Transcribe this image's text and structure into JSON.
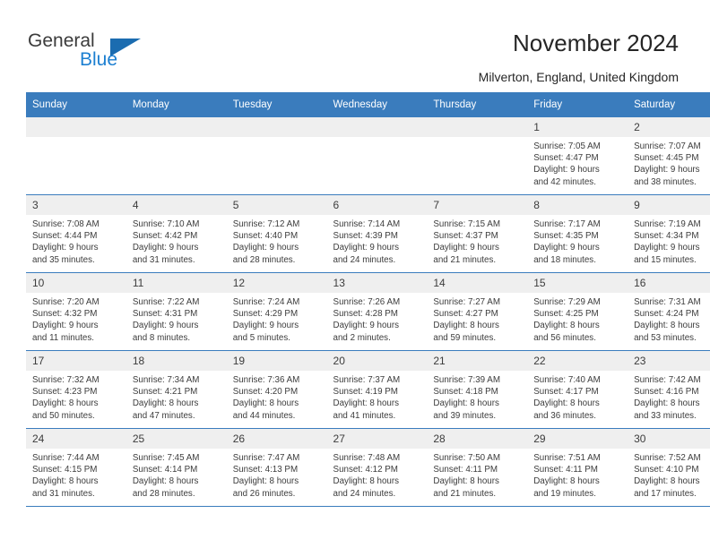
{
  "brand": {
    "name_part1": "General",
    "name_part2": "Blue",
    "accent_color": "#1b6cb0"
  },
  "header": {
    "title": "November 2024",
    "subtitle": "Milverton, England, United Kingdom"
  },
  "calendar": {
    "header_color": "#3a7cbd",
    "daynum_background": "#efefef",
    "weekday_headers": [
      "Sunday",
      "Monday",
      "Tuesday",
      "Wednesday",
      "Thursday",
      "Friday",
      "Saturday"
    ],
    "weeks": [
      [
        {
          "day": "",
          "sunrise": "",
          "sunset": "",
          "daylight": "",
          "daylight2": ""
        },
        {
          "day": "",
          "sunrise": "",
          "sunset": "",
          "daylight": "",
          "daylight2": ""
        },
        {
          "day": "",
          "sunrise": "",
          "sunset": "",
          "daylight": "",
          "daylight2": ""
        },
        {
          "day": "",
          "sunrise": "",
          "sunset": "",
          "daylight": "",
          "daylight2": ""
        },
        {
          "day": "",
          "sunrise": "",
          "sunset": "",
          "daylight": "",
          "daylight2": ""
        },
        {
          "day": "1",
          "sunrise": "Sunrise: 7:05 AM",
          "sunset": "Sunset: 4:47 PM",
          "daylight": "Daylight: 9 hours",
          "daylight2": "and 42 minutes."
        },
        {
          "day": "2",
          "sunrise": "Sunrise: 7:07 AM",
          "sunset": "Sunset: 4:45 PM",
          "daylight": "Daylight: 9 hours",
          "daylight2": "and 38 minutes."
        }
      ],
      [
        {
          "day": "3",
          "sunrise": "Sunrise: 7:08 AM",
          "sunset": "Sunset: 4:44 PM",
          "daylight": "Daylight: 9 hours",
          "daylight2": "and 35 minutes."
        },
        {
          "day": "4",
          "sunrise": "Sunrise: 7:10 AM",
          "sunset": "Sunset: 4:42 PM",
          "daylight": "Daylight: 9 hours",
          "daylight2": "and 31 minutes."
        },
        {
          "day": "5",
          "sunrise": "Sunrise: 7:12 AM",
          "sunset": "Sunset: 4:40 PM",
          "daylight": "Daylight: 9 hours",
          "daylight2": "and 28 minutes."
        },
        {
          "day": "6",
          "sunrise": "Sunrise: 7:14 AM",
          "sunset": "Sunset: 4:39 PM",
          "daylight": "Daylight: 9 hours",
          "daylight2": "and 24 minutes."
        },
        {
          "day": "7",
          "sunrise": "Sunrise: 7:15 AM",
          "sunset": "Sunset: 4:37 PM",
          "daylight": "Daylight: 9 hours",
          "daylight2": "and 21 minutes."
        },
        {
          "day": "8",
          "sunrise": "Sunrise: 7:17 AM",
          "sunset": "Sunset: 4:35 PM",
          "daylight": "Daylight: 9 hours",
          "daylight2": "and 18 minutes."
        },
        {
          "day": "9",
          "sunrise": "Sunrise: 7:19 AM",
          "sunset": "Sunset: 4:34 PM",
          "daylight": "Daylight: 9 hours",
          "daylight2": "and 15 minutes."
        }
      ],
      [
        {
          "day": "10",
          "sunrise": "Sunrise: 7:20 AM",
          "sunset": "Sunset: 4:32 PM",
          "daylight": "Daylight: 9 hours",
          "daylight2": "and 11 minutes."
        },
        {
          "day": "11",
          "sunrise": "Sunrise: 7:22 AM",
          "sunset": "Sunset: 4:31 PM",
          "daylight": "Daylight: 9 hours",
          "daylight2": "and 8 minutes."
        },
        {
          "day": "12",
          "sunrise": "Sunrise: 7:24 AM",
          "sunset": "Sunset: 4:29 PM",
          "daylight": "Daylight: 9 hours",
          "daylight2": "and 5 minutes."
        },
        {
          "day": "13",
          "sunrise": "Sunrise: 7:26 AM",
          "sunset": "Sunset: 4:28 PM",
          "daylight": "Daylight: 9 hours",
          "daylight2": "and 2 minutes."
        },
        {
          "day": "14",
          "sunrise": "Sunrise: 7:27 AM",
          "sunset": "Sunset: 4:27 PM",
          "daylight": "Daylight: 8 hours",
          "daylight2": "and 59 minutes."
        },
        {
          "day": "15",
          "sunrise": "Sunrise: 7:29 AM",
          "sunset": "Sunset: 4:25 PM",
          "daylight": "Daylight: 8 hours",
          "daylight2": "and 56 minutes."
        },
        {
          "day": "16",
          "sunrise": "Sunrise: 7:31 AM",
          "sunset": "Sunset: 4:24 PM",
          "daylight": "Daylight: 8 hours",
          "daylight2": "and 53 minutes."
        }
      ],
      [
        {
          "day": "17",
          "sunrise": "Sunrise: 7:32 AM",
          "sunset": "Sunset: 4:23 PM",
          "daylight": "Daylight: 8 hours",
          "daylight2": "and 50 minutes."
        },
        {
          "day": "18",
          "sunrise": "Sunrise: 7:34 AM",
          "sunset": "Sunset: 4:21 PM",
          "daylight": "Daylight: 8 hours",
          "daylight2": "and 47 minutes."
        },
        {
          "day": "19",
          "sunrise": "Sunrise: 7:36 AM",
          "sunset": "Sunset: 4:20 PM",
          "daylight": "Daylight: 8 hours",
          "daylight2": "and 44 minutes."
        },
        {
          "day": "20",
          "sunrise": "Sunrise: 7:37 AM",
          "sunset": "Sunset: 4:19 PM",
          "daylight": "Daylight: 8 hours",
          "daylight2": "and 41 minutes."
        },
        {
          "day": "21",
          "sunrise": "Sunrise: 7:39 AM",
          "sunset": "Sunset: 4:18 PM",
          "daylight": "Daylight: 8 hours",
          "daylight2": "and 39 minutes."
        },
        {
          "day": "22",
          "sunrise": "Sunrise: 7:40 AM",
          "sunset": "Sunset: 4:17 PM",
          "daylight": "Daylight: 8 hours",
          "daylight2": "and 36 minutes."
        },
        {
          "day": "23",
          "sunrise": "Sunrise: 7:42 AM",
          "sunset": "Sunset: 4:16 PM",
          "daylight": "Daylight: 8 hours",
          "daylight2": "and 33 minutes."
        }
      ],
      [
        {
          "day": "24",
          "sunrise": "Sunrise: 7:44 AM",
          "sunset": "Sunset: 4:15 PM",
          "daylight": "Daylight: 8 hours",
          "daylight2": "and 31 minutes."
        },
        {
          "day": "25",
          "sunrise": "Sunrise: 7:45 AM",
          "sunset": "Sunset: 4:14 PM",
          "daylight": "Daylight: 8 hours",
          "daylight2": "and 28 minutes."
        },
        {
          "day": "26",
          "sunrise": "Sunrise: 7:47 AM",
          "sunset": "Sunset: 4:13 PM",
          "daylight": "Daylight: 8 hours",
          "daylight2": "and 26 minutes."
        },
        {
          "day": "27",
          "sunrise": "Sunrise: 7:48 AM",
          "sunset": "Sunset: 4:12 PM",
          "daylight": "Daylight: 8 hours",
          "daylight2": "and 24 minutes."
        },
        {
          "day": "28",
          "sunrise": "Sunrise: 7:50 AM",
          "sunset": "Sunset: 4:11 PM",
          "daylight": "Daylight: 8 hours",
          "daylight2": "and 21 minutes."
        },
        {
          "day": "29",
          "sunrise": "Sunrise: 7:51 AM",
          "sunset": "Sunset: 4:11 PM",
          "daylight": "Daylight: 8 hours",
          "daylight2": "and 19 minutes."
        },
        {
          "day": "30",
          "sunrise": "Sunrise: 7:52 AM",
          "sunset": "Sunset: 4:10 PM",
          "daylight": "Daylight: 8 hours",
          "daylight2": "and 17 minutes."
        }
      ]
    ]
  }
}
